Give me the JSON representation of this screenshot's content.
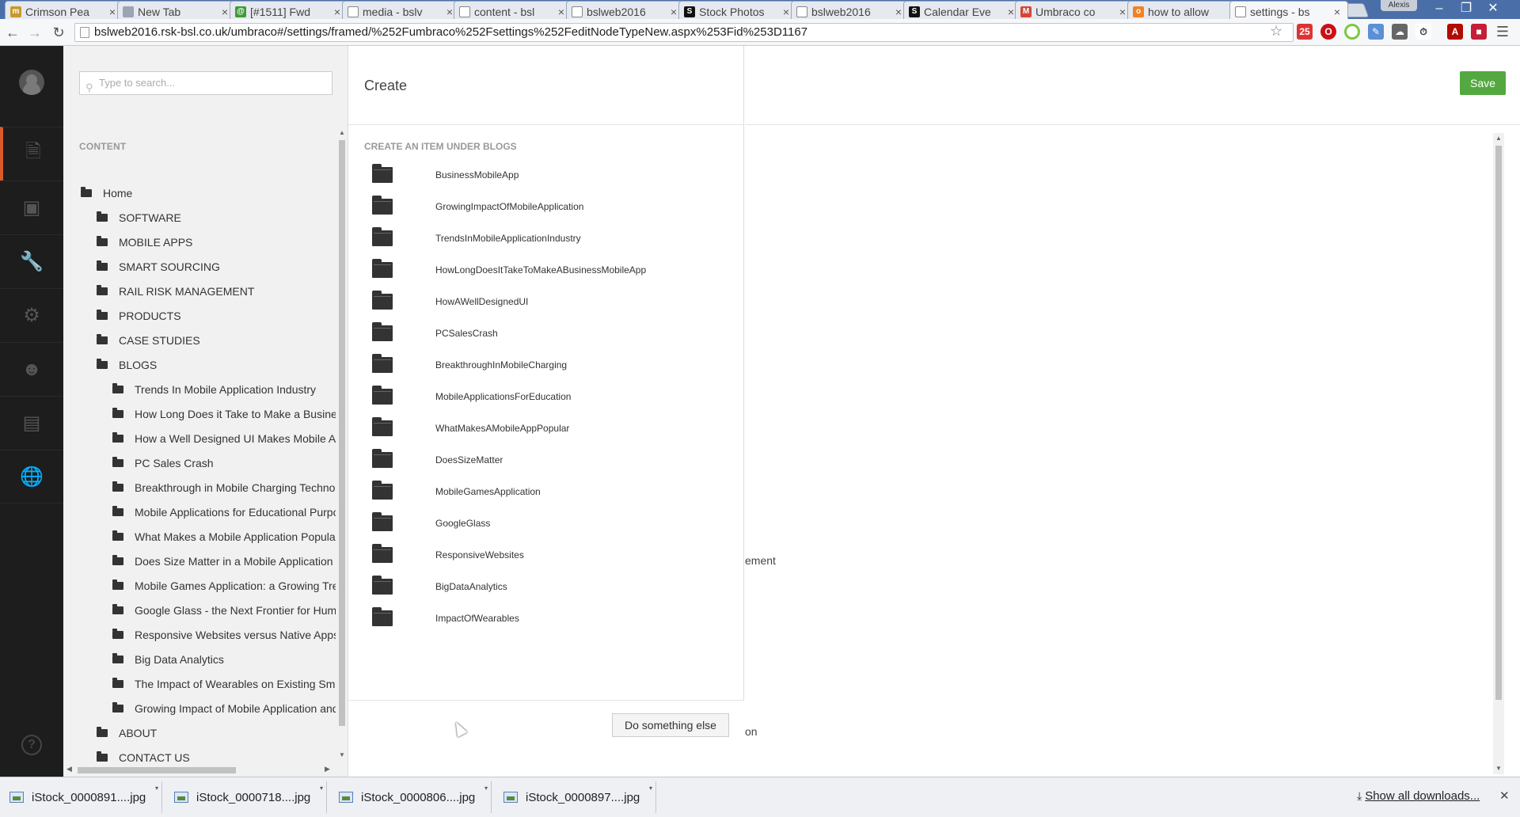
{
  "browser": {
    "tabs": [
      {
        "title": "Crimson Pea",
        "fav_color": "#c79a2b",
        "fav_glyph": "m"
      },
      {
        "title": "New Tab",
        "fav_color": "#9aa4b4",
        "fav_glyph": ""
      },
      {
        "title": "[#1511] Fwd",
        "fav_color": "#3d9b35",
        "fav_glyph": "@"
      },
      {
        "title": "media - bslv",
        "fav_color": "#ffffff",
        "fav_glyph": ""
      },
      {
        "title": "content - bsl",
        "fav_color": "#ffffff",
        "fav_glyph": ""
      },
      {
        "title": "bslweb2016",
        "fav_color": "#ffffff",
        "fav_glyph": ""
      },
      {
        "title": "Stock Photos",
        "fav_color": "#111111",
        "fav_glyph": "S"
      },
      {
        "title": "bslweb2016",
        "fav_color": "#ffffff",
        "fav_glyph": ""
      },
      {
        "title": "Calendar Eve",
        "fav_color": "#111111",
        "fav_glyph": "S"
      },
      {
        "title": "Umbraco co",
        "fav_color": "#d44638",
        "fav_glyph": "M"
      },
      {
        "title": "how to allow",
        "fav_color": "#f48024",
        "fav_glyph": "o"
      },
      {
        "title": "settings - bs",
        "fav_color": "#ffffff",
        "fav_glyph": ""
      }
    ],
    "profile_name": "Alexis",
    "url": "bslweb2016.rsk-bsl.co.uk/umbraco#/settings/framed/%252Fumbraco%252Fsettings%252FeditNodeTypeNew.aspx%253Fid%253D1167"
  },
  "tree": {
    "search_placeholder": "Type to search...",
    "section_heading": "CONTENT",
    "nodes": [
      {
        "label": "Home",
        "level": 0
      },
      {
        "label": "SOFTWARE",
        "level": 1
      },
      {
        "label": "MOBILE APPS",
        "level": 1
      },
      {
        "label": "SMART SOURCING",
        "level": 1
      },
      {
        "label": "RAIL RISK MANAGEMENT",
        "level": 1
      },
      {
        "label": "PRODUCTS",
        "level": 1
      },
      {
        "label": "CASE STUDIES",
        "level": 1
      },
      {
        "label": "BLOGS",
        "level": 1
      },
      {
        "label": "Trends In Mobile Application Industry",
        "level": 2
      },
      {
        "label": "How Long Does it Take to Make a Business Mobile App",
        "level": 2
      },
      {
        "label": "How a Well Designed UI Makes Mobile Apps",
        "level": 2
      },
      {
        "label": "PC Sales Crash",
        "level": 2
      },
      {
        "label": "Breakthrough in Mobile Charging Technology",
        "level": 2
      },
      {
        "label": "Mobile Applications for Educational Purposes",
        "level": 2
      },
      {
        "label": "What Makes a Mobile Application Popular",
        "level": 2
      },
      {
        "label": "Does Size Matter in a Mobile Application",
        "level": 2
      },
      {
        "label": "Mobile Games Application: a Growing Trend",
        "level": 2
      },
      {
        "label": "Google Glass - the Next Frontier for Human",
        "level": 2
      },
      {
        "label": "Responsive Websites versus Native Apps",
        "level": 2
      },
      {
        "label": "Big Data Analytics",
        "level": 2
      },
      {
        "label": "The Impact of Wearables on Existing Smart",
        "level": 2
      },
      {
        "label": "Growing Impact of Mobile Application and",
        "level": 2
      },
      {
        "label": "ABOUT",
        "level": 1
      },
      {
        "label": "CONTACT US",
        "level": 1
      }
    ]
  },
  "dialog": {
    "title": "Create",
    "subtitle": "CREATE AN ITEM UNDER BLOGS",
    "items": [
      "BusinessMobileApp",
      "GrowingImpactOfMobileApplication",
      "TrendsInMobileApplicationIndustry",
      "HowLongDoesItTakeToMakeABusinessMobileApp",
      "HowAWellDesignedUI",
      "PCSalesCrash",
      "BreakthroughInMobileCharging",
      "MobileApplicationsForEducation",
      "WhatMakesAMobileAppPopular",
      "DoesSizeMatter",
      "MobileGamesApplication",
      "GoogleGlass",
      "ResponsiveWebsites",
      "BigDataAnalytics",
      "ImpactOfWearables"
    ],
    "footer_button": "Do something else"
  },
  "editor": {
    "save_label": "Save",
    "ghost_text_1": "ement",
    "ghost_text_2": "on"
  },
  "downloads": {
    "files": [
      "iStock_0000891....jpg",
      "iStock_0000718....jpg",
      "iStock_0000806....jpg",
      "iStock_0000897....jpg"
    ],
    "show_all": "Show all downloads..."
  },
  "colors": {
    "save_green": "#53a93f",
    "nav_dark": "#1d1d1d",
    "active_section_accent": "#d95b28"
  }
}
